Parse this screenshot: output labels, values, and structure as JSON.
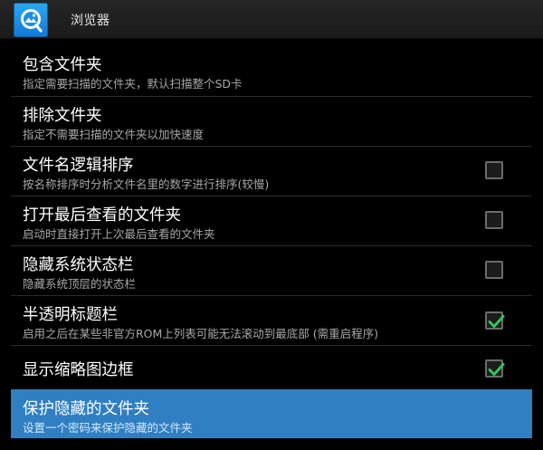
{
  "action_bar": {
    "icon": "app-logo-icon",
    "title": "浏览器"
  },
  "preferences": [
    {
      "title": "包含文件夹",
      "summary": "指定需要扫描的文件夹，默认扫描整个SD卡",
      "checkbox": null
    },
    {
      "title": "排除文件夹",
      "summary": "指定不需要扫描的文件夹以加快速度",
      "checkbox": null
    },
    {
      "title": "文件名逻辑排序",
      "summary": "按名称排序时分析文件名里的数字进行排序(较慢)",
      "checkbox": false
    },
    {
      "title": "打开最后查看的文件夹",
      "summary": "启动时直接打开上次最后查看的文件夹",
      "checkbox": false
    },
    {
      "title": "隐藏系统状态栏",
      "summary": "隐藏系统顶层的状态栏",
      "checkbox": false
    },
    {
      "title": "半透明标题栏",
      "summary": "启用之后在某些非官方ROM上列表可能无法滚动到最底部 (需重启程序)",
      "checkbox": true
    },
    {
      "title": "显示缩略图边框",
      "summary": "",
      "checkbox": true
    },
    {
      "title": "保护隐藏的文件夹",
      "summary": "设置一个密码来保护隐藏的文件夹",
      "checkbox": null,
      "selected": true
    }
  ],
  "colors": {
    "selected_row": "#2f7fc2",
    "checkmark": "#33c45a",
    "action_bar": "#1f1f1f"
  }
}
